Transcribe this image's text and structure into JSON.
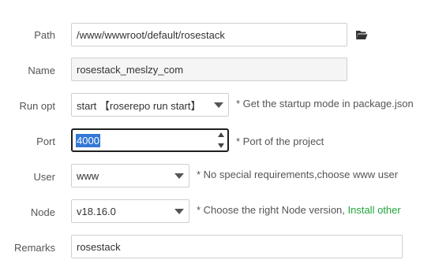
{
  "form": {
    "path": {
      "label": "Path",
      "value": "/www/wwwroot/default/rosestack"
    },
    "name": {
      "label": "Name",
      "value": "rosestack_meslzy_com"
    },
    "run_opt": {
      "label": "Run opt",
      "value": "start 【roserepo run start】",
      "hint": "* Get the startup mode in package.json"
    },
    "port": {
      "label": "Port",
      "value": "4000",
      "hint": "* Port of the project"
    },
    "user": {
      "label": "User",
      "value": "www",
      "hint": "* No special requirements,choose www user"
    },
    "node": {
      "label": "Node",
      "value": "v18.16.0",
      "hint": "* Choose the right Node version, ",
      "install_link": "Install other"
    },
    "remarks": {
      "label": "Remarks",
      "value": "rosestack"
    }
  },
  "icons": {
    "folder": "folder-open-icon"
  },
  "colors": {
    "link": "#20a53a",
    "selection": "#3478d4"
  }
}
